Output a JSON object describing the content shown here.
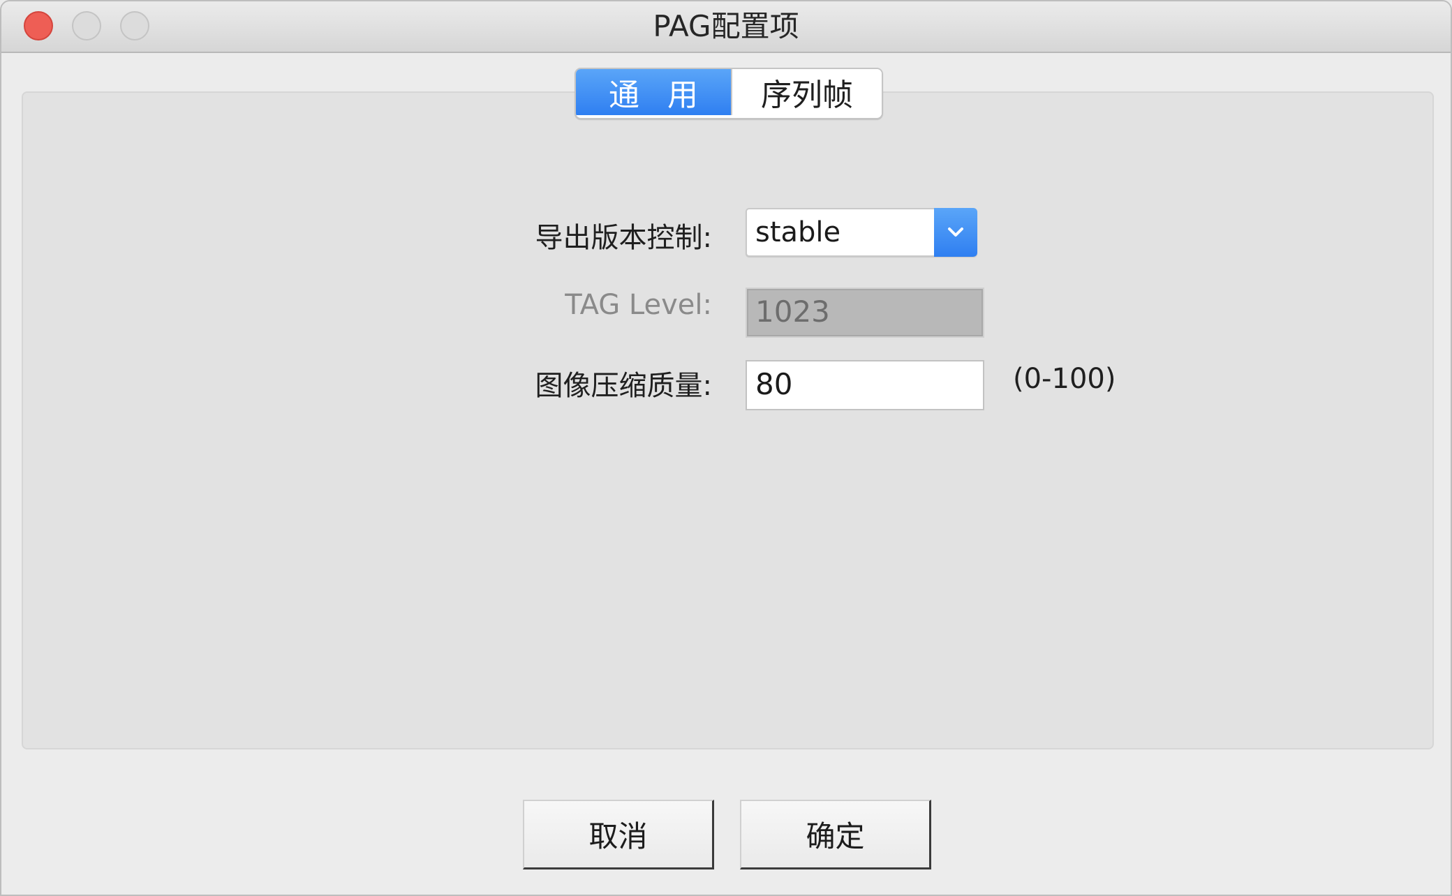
{
  "window": {
    "title": "PAG配置项"
  },
  "tabs": [
    {
      "label": "通用",
      "active": true
    },
    {
      "label": "序列帧",
      "active": false
    }
  ],
  "form": {
    "export_version": {
      "label": "导出版本控制:",
      "value": "stable"
    },
    "tag_level": {
      "label": "TAG Level:",
      "value": "1023",
      "disabled": true
    },
    "image_quality": {
      "label": "图像压缩质量:",
      "value": "80",
      "range": "(0-100)"
    }
  },
  "buttons": {
    "cancel": "取消",
    "ok": "确定"
  },
  "icons": {
    "close": "close-traffic-light-icon",
    "minimize": "minimize-traffic-light-icon",
    "maximize": "maximize-traffic-light-icon",
    "dropdown": "chevron-down-icon"
  },
  "colors": {
    "accent": "#3b8cf5",
    "close": "#ee5e55"
  }
}
